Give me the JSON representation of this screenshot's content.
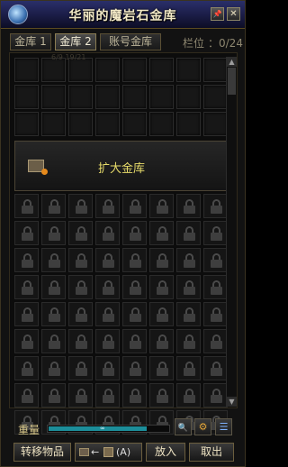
{
  "window": {
    "title": "华丽的魔岩石金库"
  },
  "titlebar": {
    "pin_glyph": "📌",
    "close_glyph": "✕"
  },
  "tabs": [
    {
      "label": "金库 1",
      "active": false
    },
    {
      "label": "金库 2",
      "active": true
    },
    {
      "label": "账号金库",
      "active": false
    }
  ],
  "slots": {
    "label": "栏位",
    "value": "：0/24"
  },
  "grid": {
    "faint_text": "6/9 19/21",
    "expand_label": "扩大金库"
  },
  "scroll": {
    "up": "▲",
    "down": "▼"
  },
  "weight": {
    "label": "重量",
    "fill_fraction": 0.82,
    "marker": "∞"
  },
  "icon_buttons": {
    "search": "🔍",
    "settings": "⚙",
    "list": "☰"
  },
  "buttons": {
    "transfer": "转移物品",
    "auto_arrow": "←",
    "auto_hotkey": "(A)",
    "put": "放入",
    "take": "取出"
  }
}
